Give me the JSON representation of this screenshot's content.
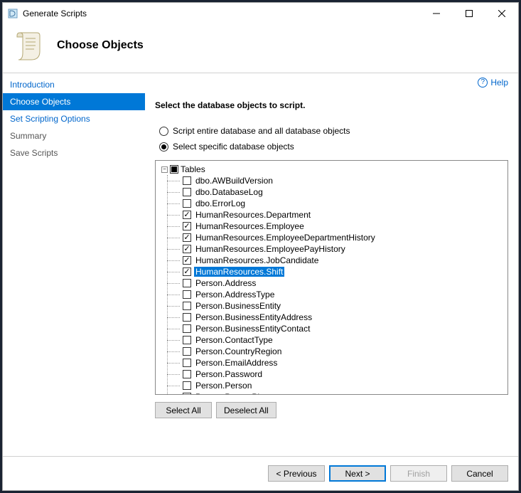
{
  "window": {
    "title": "Generate Scripts"
  },
  "header": {
    "title": "Choose Objects"
  },
  "sidebar": {
    "items": [
      {
        "label": "Introduction",
        "state": "visited"
      },
      {
        "label": "Choose Objects",
        "state": "active"
      },
      {
        "label": "Set Scripting Options",
        "state": "visited"
      },
      {
        "label": "Summary",
        "state": "future"
      },
      {
        "label": "Save Scripts",
        "state": "future"
      }
    ]
  },
  "help": {
    "label": "Help"
  },
  "main": {
    "section_title": "Select the database objects to script.",
    "radio_all": "Script entire database and all database objects",
    "radio_specific": "Select specific database objects",
    "radio_selected": "specific",
    "tree_root": "Tables",
    "tree_items": [
      {
        "label": "dbo.AWBuildVersion",
        "checked": false
      },
      {
        "label": "dbo.DatabaseLog",
        "checked": false
      },
      {
        "label": "dbo.ErrorLog",
        "checked": false
      },
      {
        "label": "HumanResources.Department",
        "checked": true
      },
      {
        "label": "HumanResources.Employee",
        "checked": true
      },
      {
        "label": "HumanResources.EmployeeDepartmentHistory",
        "checked": true
      },
      {
        "label": "HumanResources.EmployeePayHistory",
        "checked": true
      },
      {
        "label": "HumanResources.JobCandidate",
        "checked": true
      },
      {
        "label": "HumanResources.Shift",
        "checked": true,
        "selected": true
      },
      {
        "label": "Person.Address",
        "checked": false
      },
      {
        "label": "Person.AddressType",
        "checked": false
      },
      {
        "label": "Person.BusinessEntity",
        "checked": false
      },
      {
        "label": "Person.BusinessEntityAddress",
        "checked": false
      },
      {
        "label": "Person.BusinessEntityContact",
        "checked": false
      },
      {
        "label": "Person.ContactType",
        "checked": false
      },
      {
        "label": "Person.CountryRegion",
        "checked": false
      },
      {
        "label": "Person.EmailAddress",
        "checked": false
      },
      {
        "label": "Person.Password",
        "checked": false
      },
      {
        "label": "Person.Person",
        "checked": false
      },
      {
        "label": "Person.PersonPhone",
        "checked": false
      }
    ],
    "select_all": "Select All",
    "deselect_all": "Deselect All"
  },
  "footer": {
    "previous": "< Previous",
    "next": "Next >",
    "finish": "Finish",
    "cancel": "Cancel"
  }
}
